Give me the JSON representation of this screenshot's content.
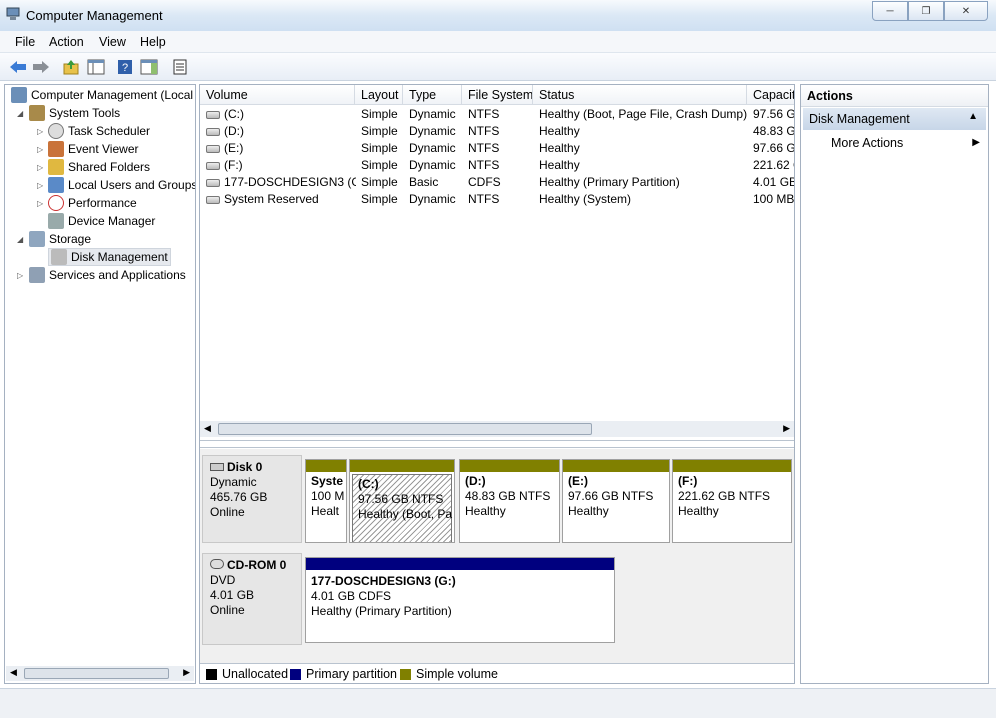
{
  "window": {
    "title": "Computer Management"
  },
  "menu": {
    "file": "File",
    "action": "Action",
    "view": "View",
    "help": "Help"
  },
  "tree": {
    "root": "Computer Management (Local",
    "system_tools": "System Tools",
    "task_scheduler": "Task Scheduler",
    "event_viewer": "Event Viewer",
    "shared_folders": "Shared Folders",
    "local_users": "Local Users and Groups",
    "performance": "Performance",
    "device_manager": "Device Manager",
    "storage": "Storage",
    "disk_management": "Disk Management",
    "services": "Services and Applications"
  },
  "list": {
    "headers": {
      "volume": "Volume",
      "layout": "Layout",
      "type": "Type",
      "fs": "File System",
      "status": "Status",
      "capacity": "Capacit"
    },
    "rows": [
      {
        "volume": "(C:)",
        "layout": "Simple",
        "type": "Dynamic",
        "fs": "NTFS",
        "status": "Healthy (Boot, Page File, Crash Dump)",
        "capacity": "97.56 GB"
      },
      {
        "volume": "(D:)",
        "layout": "Simple",
        "type": "Dynamic",
        "fs": "NTFS",
        "status": "Healthy",
        "capacity": "48.83 GB"
      },
      {
        "volume": "(E:)",
        "layout": "Simple",
        "type": "Dynamic",
        "fs": "NTFS",
        "status": "Healthy",
        "capacity": "97.66 GB"
      },
      {
        "volume": "(F:)",
        "layout": "Simple",
        "type": "Dynamic",
        "fs": "NTFS",
        "status": "Healthy",
        "capacity": "221.62 G"
      },
      {
        "volume": "177-DOSCHDESIGN3 (G:)",
        "layout": "Simple",
        "type": "Basic",
        "fs": "CDFS",
        "status": "Healthy (Primary Partition)",
        "capacity": "4.01 GB"
      },
      {
        "volume": "System Reserved",
        "layout": "Simple",
        "type": "Dynamic",
        "fs": "NTFS",
        "status": "Healthy (System)",
        "capacity": "100 MB"
      }
    ]
  },
  "disk0": {
    "name": "Disk 0",
    "kind": "Dynamic",
    "size": "465.76 GB",
    "state": "Online",
    "parts": [
      {
        "name": "Syste",
        "size": "100 M",
        "health": "Healt"
      },
      {
        "name": "(C:)",
        "size": "97.56 GB NTFS",
        "health": "Healthy (Boot, Pa"
      },
      {
        "name": "(D:)",
        "size": "48.83 GB NTFS",
        "health": "Healthy"
      },
      {
        "name": "(E:)",
        "size": "97.66 GB NTFS",
        "health": "Healthy"
      },
      {
        "name": "(F:)",
        "size": "221.62 GB NTFS",
        "health": "Healthy"
      }
    ]
  },
  "cdrom0": {
    "name": "CD-ROM 0",
    "kind": "DVD",
    "size": "4.01 GB",
    "state": "Online",
    "part": {
      "name": "177-DOSCHDESIGN3  (G:)",
      "size": "4.01 GB CDFS",
      "health": "Healthy (Primary Partition)"
    }
  },
  "legend": {
    "unallocated": "Unallocated",
    "primary": "Primary partition",
    "simple": "Simple volume"
  },
  "colors": {
    "unallocated": "#000000",
    "primary": "#00007f",
    "simple": "#808000"
  },
  "actions": {
    "header": "Actions",
    "section": "Disk Management",
    "more": "More Actions"
  }
}
